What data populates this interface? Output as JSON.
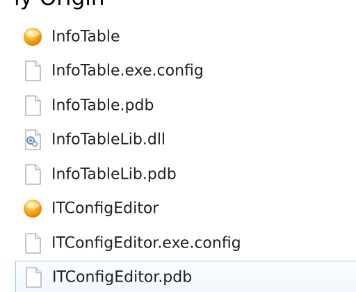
{
  "window": {
    "cut_header": "ly Origin"
  },
  "files": [
    {
      "name": "InfoTable",
      "icon": "app-orb-icon"
    },
    {
      "name": "InfoTable.exe.config",
      "icon": "document-icon"
    },
    {
      "name": "InfoTable.pdb",
      "icon": "document-icon"
    },
    {
      "name": "InfoTableLib.dll",
      "icon": "dll-icon"
    },
    {
      "name": "InfoTableLib.pdb",
      "icon": "document-icon"
    },
    {
      "name": "ITConfigEditor",
      "icon": "app-orb-icon"
    },
    {
      "name": "ITConfigEditor.exe.config",
      "icon": "document-icon"
    },
    {
      "name": "ITConfigEditor.pdb",
      "icon": "document-icon",
      "selected": true
    }
  ],
  "colors": {
    "selection_border": "#9fc6ee",
    "selection_fill": "#f1f7fe",
    "orb_orange": "#f39c12",
    "text": "#1e1e1e"
  }
}
